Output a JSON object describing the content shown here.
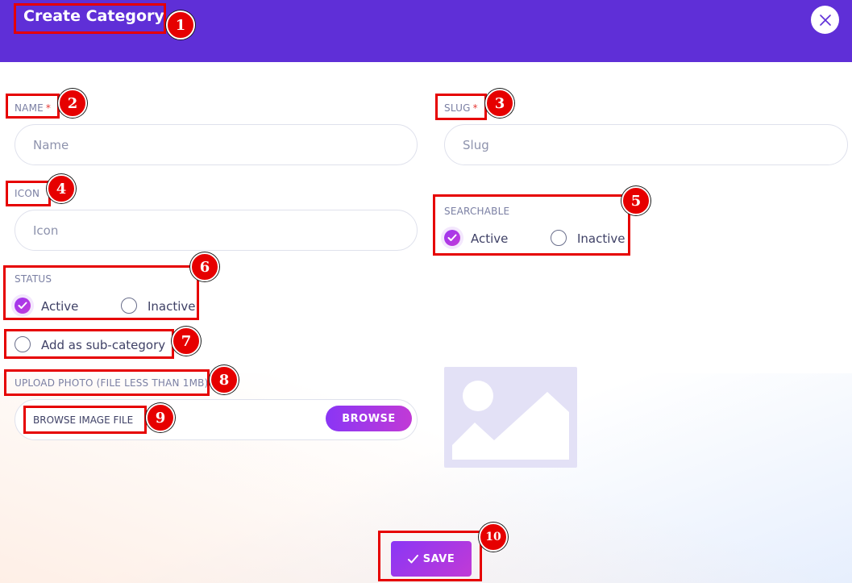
{
  "modal": {
    "title": "Create Category",
    "close_icon": "close-icon"
  },
  "form": {
    "name": {
      "label": "NAME",
      "required_mark": "*",
      "placeholder": "Name",
      "value": ""
    },
    "slug": {
      "label": "SLUG",
      "required_mark": "*",
      "placeholder": "Slug",
      "value": ""
    },
    "icon": {
      "label": "ICON",
      "placeholder": "Icon",
      "value": ""
    },
    "searchable": {
      "label": "SEARCHABLE",
      "options": [
        "Active",
        "Inactive"
      ],
      "selected": "Active"
    },
    "status": {
      "label": "STATUS",
      "options": [
        "Active",
        "Inactive"
      ],
      "selected": "Active"
    },
    "sub_category": {
      "label": "Add as sub-category",
      "checked": false
    },
    "upload": {
      "label": "UPLOAD PHOTO (FILE LESS THAN 1MB)",
      "file_text": "BROWSE IMAGE FILE",
      "browse_label": "BROWSE"
    },
    "save_label": "SAVE"
  },
  "annotations": [
    "1",
    "2",
    "3",
    "4",
    "5",
    "6",
    "7",
    "8",
    "9",
    "10"
  ],
  "colors": {
    "header": "#5f2fd7",
    "accent_start": "#8a36f5",
    "accent_end": "#c13ad6",
    "annotation": "#e60000",
    "image_placeholder": "#e3e1f6"
  }
}
